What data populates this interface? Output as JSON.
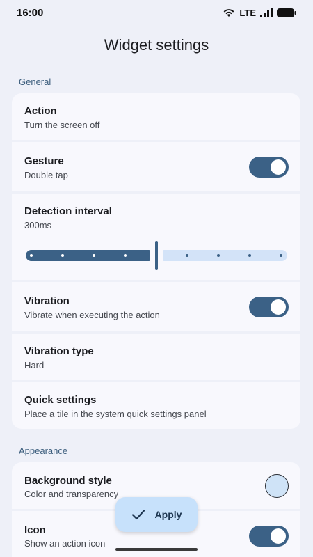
{
  "status_bar": {
    "time": "16:00",
    "network": "LTE"
  },
  "title": "Widget settings",
  "sections": {
    "general": "General",
    "appearance": "Appearance"
  },
  "rows": {
    "action": {
      "title": "Action",
      "subtitle": "Turn the screen off"
    },
    "gesture": {
      "title": "Gesture",
      "subtitle": "Double tap",
      "toggle_on": true
    },
    "detection": {
      "title": "Detection interval",
      "subtitle": "300ms",
      "slider_fraction": 0.5
    },
    "vibration": {
      "title": "Vibration",
      "subtitle": "Vibrate when executing the action",
      "toggle_on": true
    },
    "vibration_type": {
      "title": "Vibration type",
      "subtitle": "Hard"
    },
    "quick_settings": {
      "title": "Quick settings",
      "subtitle": "Place a tile in the system quick settings panel"
    },
    "background_style": {
      "title": "Background style",
      "subtitle": "Color and transparency",
      "swatch_color": "#cfe3f7"
    },
    "icon": {
      "title": "Icon",
      "subtitle": "Show an action icon",
      "toggle_on": true
    }
  },
  "fab": {
    "label": "Apply",
    "icon": "check-icon"
  },
  "colors": {
    "accent": "#3b6186",
    "background": "#eef0f8",
    "card": "#f8f8fd",
    "section": "#3b5d7c"
  }
}
